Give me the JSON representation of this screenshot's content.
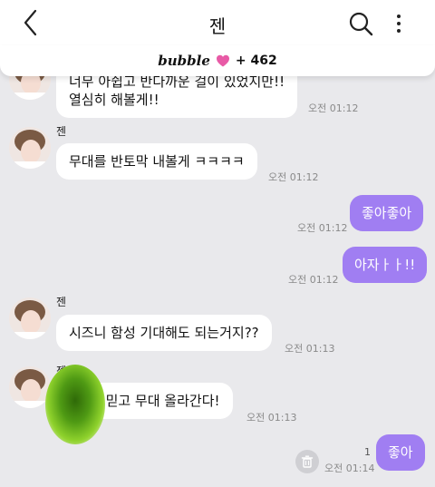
{
  "header": {
    "title": "젠",
    "back_icon": "chevron-left-icon",
    "search_icon": "search-icon",
    "more_icon": "more-vertical-icon"
  },
  "bubble_bar": {
    "brand": "bubble",
    "heart_color": "#e85aa6",
    "count": "+ 462"
  },
  "colors": {
    "outgoing_bubble": "#a07ef2",
    "incoming_bubble": "#ffffff",
    "chat_background": "#e9e9ec"
  },
  "messages": [
    {
      "id": "m1",
      "direction": "in",
      "text_line1": "너무 아쉽고 반다까운 걸이 있었지만!!",
      "text_line2": "열심히 해볼게!!",
      "time": "오전 01:12"
    },
    {
      "id": "m2",
      "direction": "in",
      "sender": "젠",
      "text": "무대를 반토막 내볼게 ㅋㅋㅋㅋ",
      "time": "오전 01:12"
    },
    {
      "id": "m3",
      "direction": "out",
      "text": "좋아좋아",
      "time": "오전 01:12"
    },
    {
      "id": "m4",
      "direction": "out",
      "text": "아자ㅏㅏ!!",
      "time": "오전 01:12"
    },
    {
      "id": "m5",
      "direction": "in",
      "sender": "젠",
      "text": "시즈니 함성 기대해도 되는거지??",
      "time": "오전 01:13"
    },
    {
      "id": "m6",
      "direction": "in",
      "sender": "젠",
      "text": "만 믿고 무대 올라간다!",
      "time": "오전 01:13"
    },
    {
      "id": "m7",
      "direction": "out",
      "text": "좋아",
      "time": "오전 01:14",
      "unread": "1"
    }
  ]
}
